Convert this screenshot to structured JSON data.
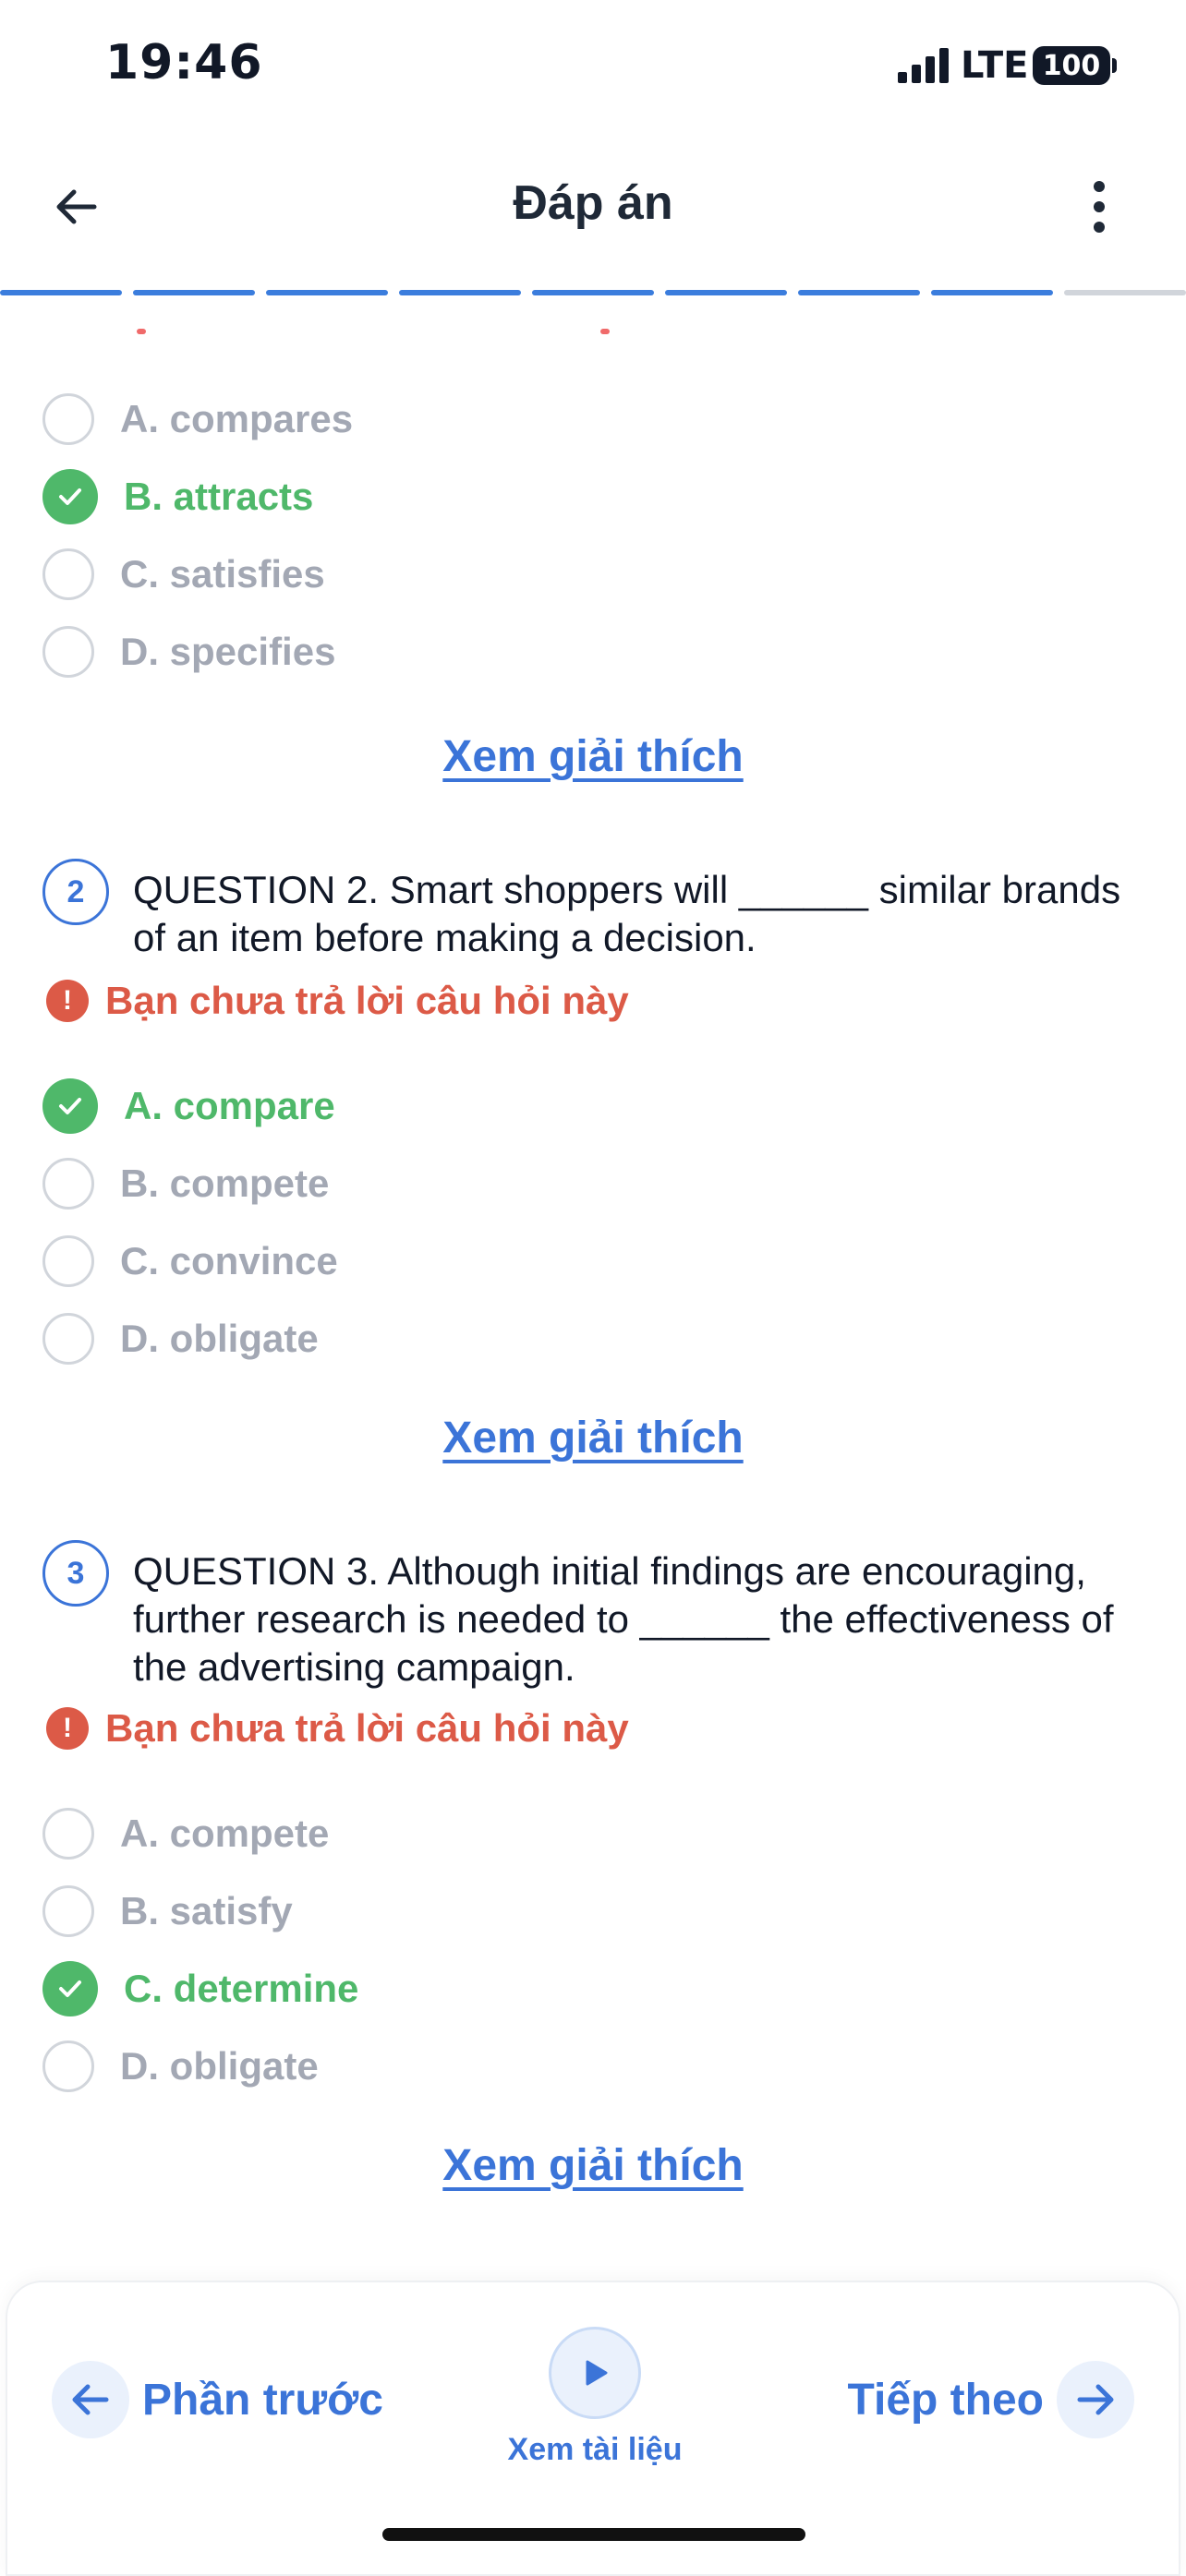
{
  "status_bar": {
    "time": "19:46",
    "network": "LTE",
    "battery": "100"
  },
  "header": {
    "title": "Đáp án",
    "back_icon": "arrow-left-icon",
    "more_icon": "more-vertical-icon"
  },
  "progress": {
    "segments_total": 9,
    "segments_completed": 8
  },
  "colors": {
    "accent": "#3b74d8",
    "correct": "#4fb86a",
    "warning": "#dc5a47",
    "muted": "#a3a8b4"
  },
  "questions": [
    {
      "options": [
        {
          "text": "A. compares",
          "correct": false
        },
        {
          "text": "B. attracts",
          "correct": true
        },
        {
          "text": "C. satisfies",
          "correct": false
        },
        {
          "text": "D. specifies",
          "correct": false
        }
      ],
      "explain_label": "Xem giải thích"
    },
    {
      "number": "2",
      "text": "QUESTION 2. Smart shoppers will ______ similar brands of an item before making a decision.",
      "warning": "Bạn chưa trả lời câu hỏi này",
      "options": [
        {
          "text": "A. compare",
          "correct": true
        },
        {
          "text": "B. compete",
          "correct": false
        },
        {
          "text": "C. convince",
          "correct": false
        },
        {
          "text": "D. obligate",
          "correct": false
        }
      ],
      "explain_label": "Xem giải thích"
    },
    {
      "number": "3",
      "text": "QUESTION 3. Although initial findings are encouraging, further research is needed to ______ the effectiveness of the advertising campaign.",
      "warning": "Bạn chưa trả lời câu hỏi này",
      "options": [
        {
          "text": "A. compete",
          "correct": false
        },
        {
          "text": "B. satisfy",
          "correct": false
        },
        {
          "text": "C. determine",
          "correct": true
        },
        {
          "text": "D. obligate",
          "correct": false
        }
      ],
      "explain_label": "Xem giải thích"
    }
  ],
  "bottom_bar": {
    "prev_label": "Phần trước",
    "doc_label": "Xem tài liệu",
    "next_label": "Tiếp theo"
  }
}
